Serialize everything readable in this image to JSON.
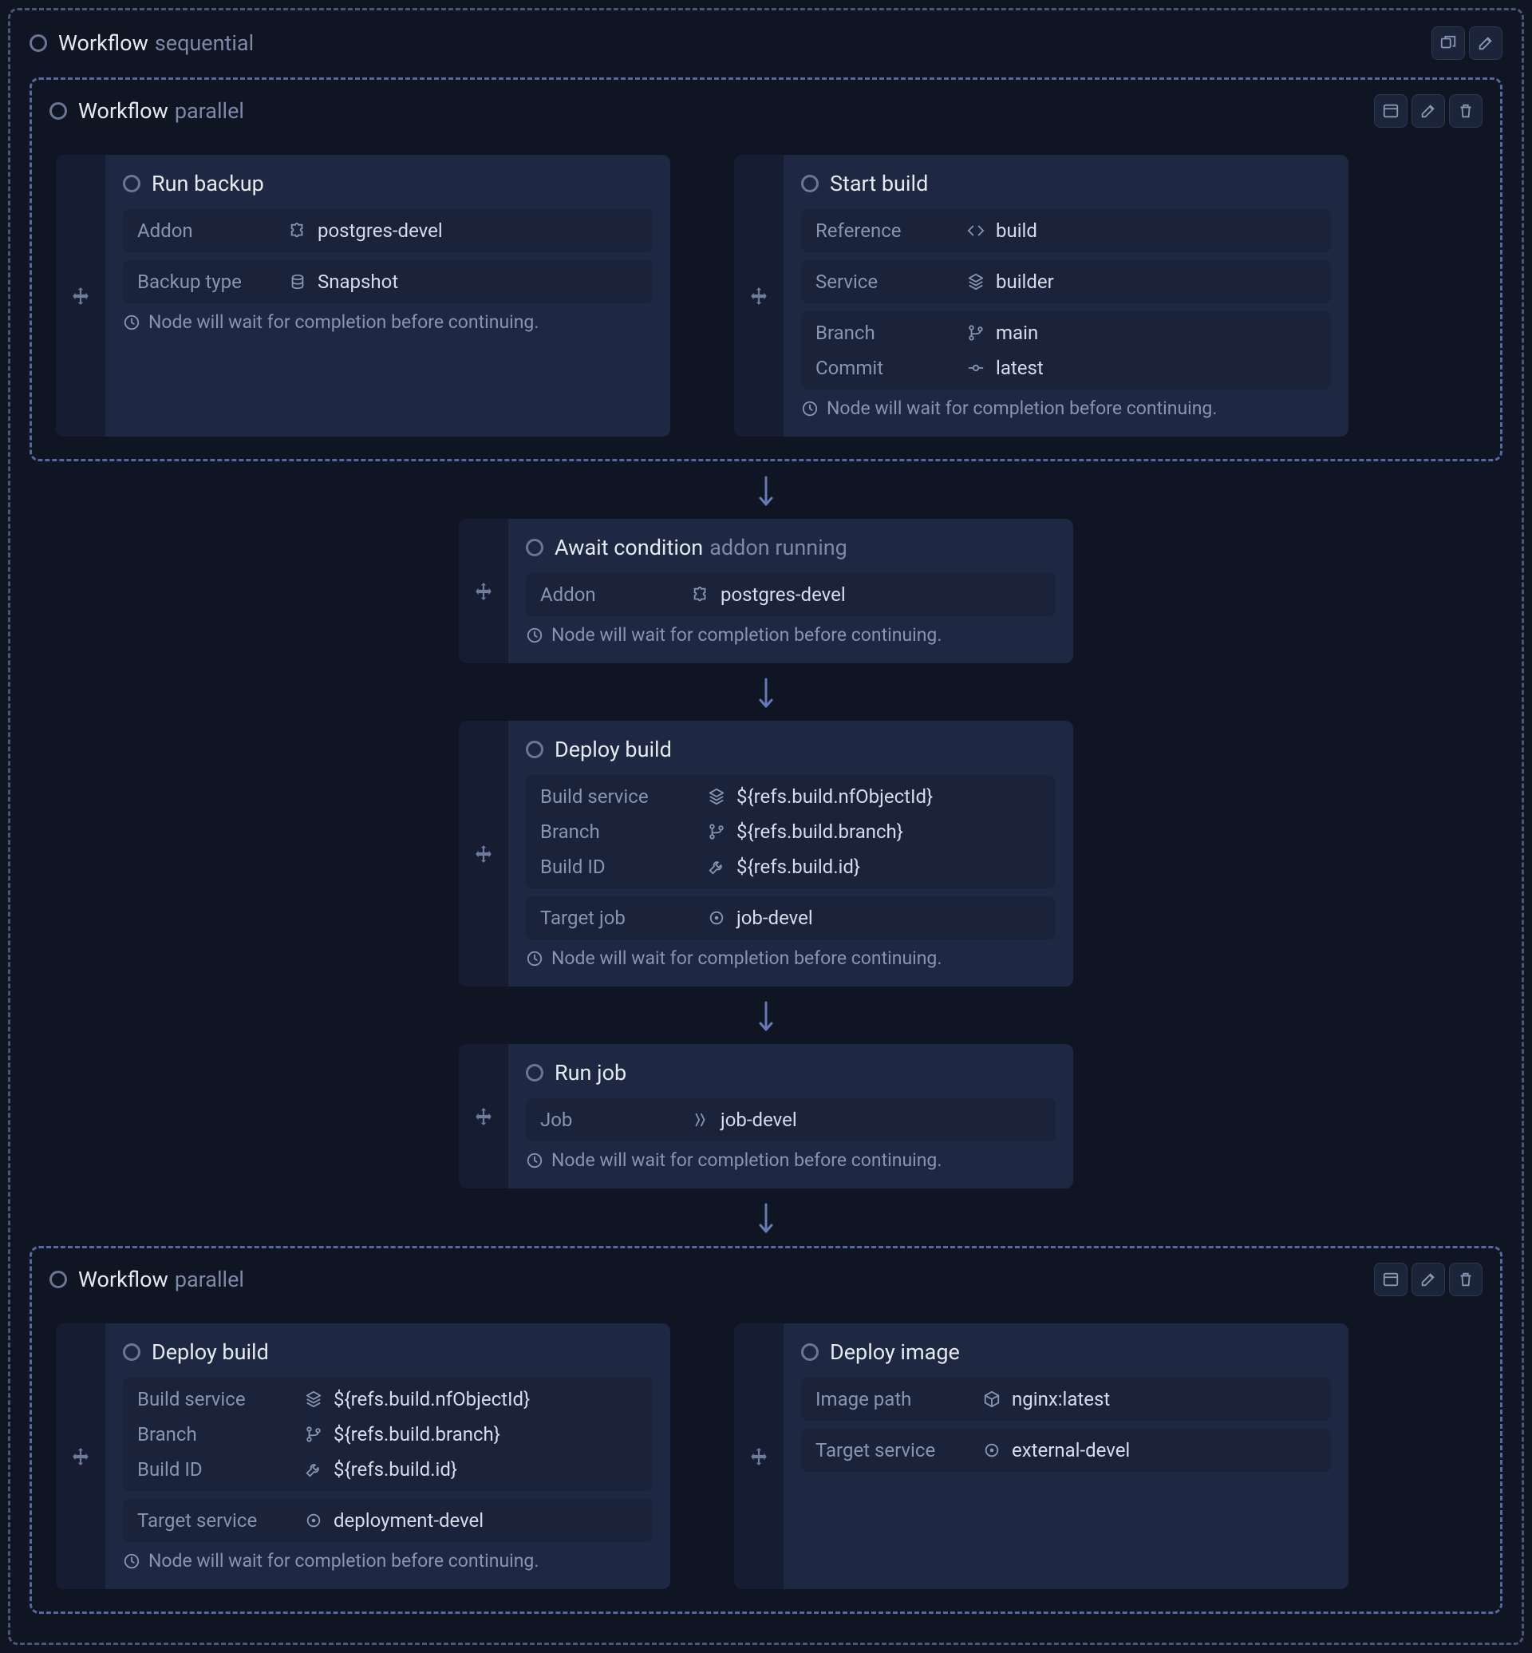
{
  "sequential": {
    "title": "Workflow",
    "subtitle": "sequential"
  },
  "parallel1": {
    "title": "Workflow",
    "subtitle": "parallel",
    "card1": {
      "title": "Run backup",
      "addon_label": "Addon",
      "addon_value": "postgres-devel",
      "backup_type_label": "Backup type",
      "backup_type_value": "Snapshot",
      "wait": "Node will wait for completion before continuing."
    },
    "card2": {
      "title": "Start build",
      "reference_label": "Reference",
      "reference_value": "build",
      "service_label": "Service",
      "service_value": "builder",
      "branch_label": "Branch",
      "branch_value": "main",
      "commit_label": "Commit",
      "commit_value": "latest",
      "wait": "Node will wait for completion before continuing."
    }
  },
  "await_card": {
    "title": "Await condition",
    "subtitle": "addon running",
    "addon_label": "Addon",
    "addon_value": "postgres-devel",
    "wait": "Node will wait for completion before continuing."
  },
  "deploy_build1": {
    "title": "Deploy build",
    "build_service_label": "Build service",
    "build_service_value": "${refs.build.nfObjectId}",
    "branch_label": "Branch",
    "branch_value": "${refs.build.branch}",
    "build_id_label": "Build ID",
    "build_id_value": "${refs.build.id}",
    "target_job_label": "Target job",
    "target_job_value": "job-devel",
    "wait": "Node will wait for completion before continuing."
  },
  "run_job": {
    "title": "Run job",
    "job_label": "Job",
    "job_value": "job-devel",
    "wait": "Node will wait for completion before continuing."
  },
  "parallel2": {
    "title": "Workflow",
    "subtitle": "parallel",
    "card1": {
      "title": "Deploy build",
      "build_service_label": "Build service",
      "build_service_value": "${refs.build.nfObjectId}",
      "branch_label": "Branch",
      "branch_value": "${refs.build.branch}",
      "build_id_label": "Build ID",
      "build_id_value": "${refs.build.id}",
      "target_service_label": "Target service",
      "target_service_value": "deployment-devel",
      "wait": "Node will wait for completion before continuing."
    },
    "card2": {
      "title": "Deploy image",
      "image_path_label": "Image path",
      "image_path_value": "nginx:latest",
      "target_service_label": "Target service",
      "target_service_value": "external-devel"
    }
  }
}
